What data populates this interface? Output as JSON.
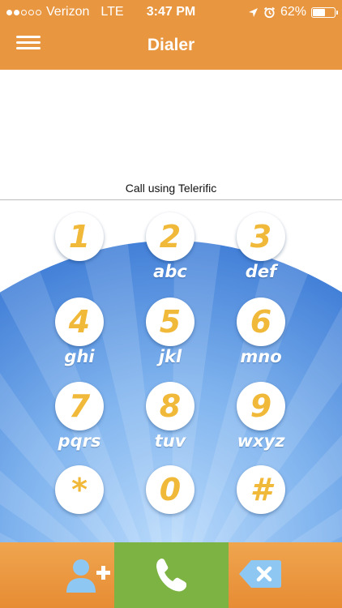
{
  "status_bar": {
    "carrier": "Verizon",
    "network": "LTE",
    "time": "3:47 PM",
    "battery": "62%",
    "battery_level": 0.62,
    "signal_bars": 2,
    "signal_total": 5
  },
  "header": {
    "title": "Dialer",
    "menu_icon": "hamburger-menu-icon"
  },
  "dialer": {
    "number": "",
    "call_using": "Call using Telerific"
  },
  "keypad": {
    "keys": [
      {
        "digit": "1",
        "letters": ""
      },
      {
        "digit": "2",
        "letters": "abc"
      },
      {
        "digit": "3",
        "letters": "def"
      },
      {
        "digit": "4",
        "letters": "ghi"
      },
      {
        "digit": "5",
        "letters": "jkl"
      },
      {
        "digit": "6",
        "letters": "mno"
      },
      {
        "digit": "7",
        "letters": "pqrs"
      },
      {
        "digit": "8",
        "letters": "tuv"
      },
      {
        "digit": "9",
        "letters": "wxyz"
      },
      {
        "digit": "*",
        "letters": ""
      },
      {
        "digit": "0",
        "letters": ""
      },
      {
        "digit": "#",
        "letters": ""
      }
    ]
  },
  "actions": {
    "add_contact_icon": "add-contact-icon",
    "call_icon": "phone-icon",
    "delete_icon": "backspace-icon"
  },
  "colors": {
    "accent_orange": "#e89640",
    "call_green": "#7cb342",
    "keypad_blue": "#3a7ad6",
    "digit_yellow": "#f1b93a"
  }
}
